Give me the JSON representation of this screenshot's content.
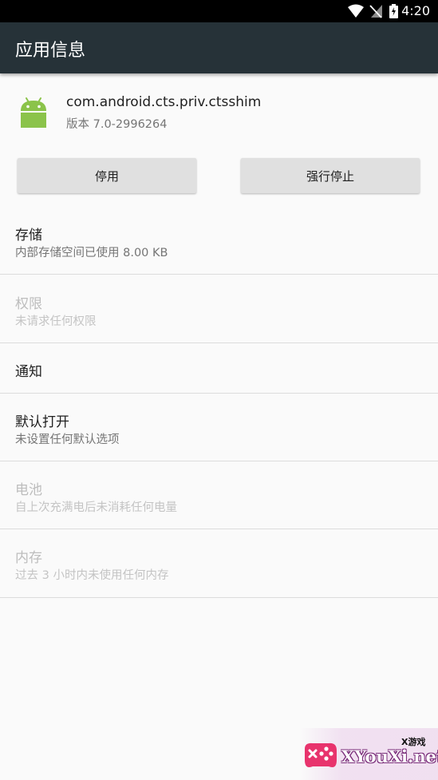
{
  "status_bar": {
    "time": "4:20"
  },
  "app_bar": {
    "title": "应用信息"
  },
  "app": {
    "package": "com.android.cts.priv.ctsshim",
    "version": "版本 7.0-2996264"
  },
  "buttons": {
    "disable": "停用",
    "force_stop": "强行停止"
  },
  "rows": [
    {
      "title": "存储",
      "subtitle": "内部存储空间已使用 8.00 KB",
      "enabled": true
    },
    {
      "title": "权限",
      "subtitle": "未请求任何权限",
      "enabled": false
    },
    {
      "title": "通知",
      "enabled": true
    },
    {
      "title": "默认打开",
      "subtitle": "未设置任何默认选项",
      "enabled": true
    },
    {
      "title": "电池",
      "subtitle": "自上次充满电后未消耗任何电量",
      "enabled": false
    },
    {
      "title": "内存",
      "subtitle": "过去 3 小时内未使用任何内存",
      "enabled": false
    }
  ],
  "watermark": {
    "brand": "XYouXi.net",
    "tag": "X游戏"
  },
  "colors": {
    "app_bar": "#263238",
    "status_bar": "#000000",
    "android_green": "#8BC34A",
    "button_bg": "#E0E0E0"
  }
}
